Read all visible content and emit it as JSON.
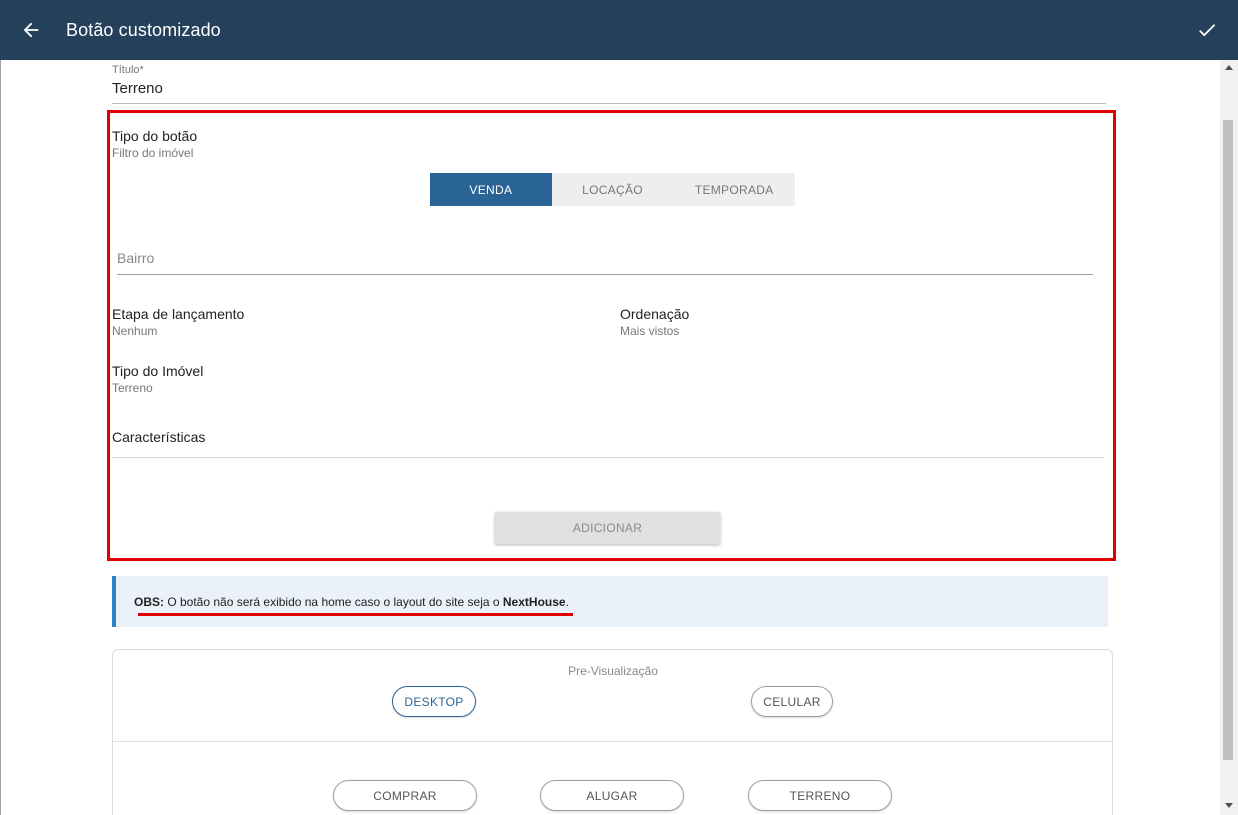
{
  "appbar": {
    "title": "Botão customizado",
    "back_icon": "arrow-left-icon",
    "confirm_icon": "check-icon"
  },
  "form": {
    "title_label": "Título*",
    "title_value": "Terreno",
    "tipo_botao_label": "Tipo do botão",
    "tipo_botao_value": "Filtro do imóvel",
    "toggle": {
      "options": [
        "VENDA",
        "LOCAÇÃO",
        "TEMPORADA"
      ],
      "selected": "VENDA"
    },
    "bairro_placeholder": "Bairro",
    "etapa_label": "Etapa de lançamento",
    "etapa_value": "Nenhum",
    "ordenacao_label": "Ordenação",
    "ordenacao_value": "Mais vistos",
    "tipo_imovel_label": "Tipo do Imóvel",
    "tipo_imovel_value": "Terreno",
    "caracteristicas_label": "Características",
    "adicionar_label": "ADICIONAR"
  },
  "obs": {
    "prefix": "OBS:",
    "text": " O botão não será exibido na home caso o layout do site seja o ",
    "brand": "NextHouse",
    "suffix": "."
  },
  "preview": {
    "title": "Pre-Visualização",
    "desktop_label": "DESKTOP",
    "celular_label": "CELULAR",
    "selected": "DESKTOP",
    "buttons": [
      "COMPRAR",
      "ALUGAR",
      "TERRENO"
    ]
  },
  "colors": {
    "appbar": "#24405a",
    "accent": "#2a6496",
    "highlight_border": "#e00000",
    "obs_background": "#eaf1f8",
    "obs_border": "#2a85c0"
  }
}
